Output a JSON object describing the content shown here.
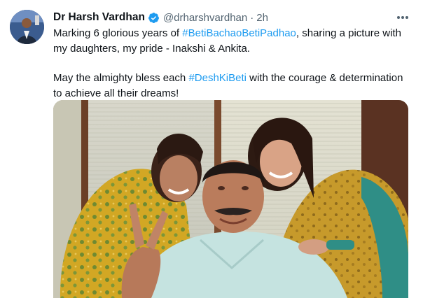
{
  "tweet": {
    "author": {
      "name": "Dr Harsh Vardhan",
      "handle": "@drharshvardhan",
      "separator": "·",
      "verified": true
    },
    "timestamp": "2h",
    "text": {
      "p1_before": "Marking 6 glorious years of ",
      "p1_hashtag": "#BetiBachaoBetiPadhao",
      "p1_after": ", sharing a picture with my daughters, my pride - Inakshi & Ankita.",
      "p2_before": "May the almighty bless each ",
      "p2_hashtag": "#DeshKiBeti",
      "p2_after": " with the courage & determination to achieve all their dreams!"
    },
    "icons": {
      "verified": "verified-badge-icon",
      "more": "more-horizontal-icon"
    },
    "colors": {
      "accent": "#1d9bf0",
      "text": "#0f1419",
      "secondary_text": "#536471"
    }
  }
}
